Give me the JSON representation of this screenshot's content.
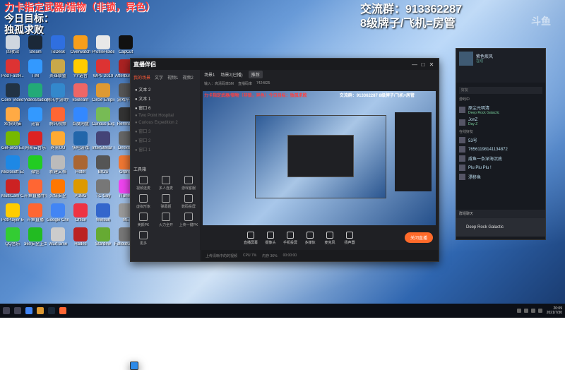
{
  "overlay": {
    "line1": "力卡指定武器/猎物（非锁，异色）",
    "line2": "今日目标：",
    "line3": "独孤求败",
    "group_label": "交流群：913362287",
    "tier_label": "8级牌子/飞机=房管",
    "watermark": "斗鱼"
  },
  "desktop_icons": [
    {
      "label": "回收站",
      "color": "#cfd6df"
    },
    {
      "label": "Steam",
      "color": "#1b2838"
    },
    {
      "label": "ToDesk",
      "color": "#2f6fe0"
    },
    {
      "label": "Overwatch",
      "color": "#f79e1b"
    },
    {
      "label": "ProfileHolder",
      "color": "#e8e8e8"
    },
    {
      "label": "CapCut",
      "color": "#111"
    },
    {
      "label": "Pod FastR...",
      "color": "#d33"
    },
    {
      "label": "TIM",
      "color": "#39f"
    },
    {
      "label": "英雄联盟",
      "color": "#c9a84a"
    },
    {
      "label": "YY语音",
      "color": "#ffcc00"
    },
    {
      "label": "WPS 2019",
      "color": "#d33"
    },
    {
      "label": "Afterburner",
      "color": "#a22"
    },
    {
      "label": "Corel VideoStudio",
      "color": "#234"
    },
    {
      "label": "VideoStudio",
      "color": "#2a7"
    },
    {
      "label": "腾讯手游助手",
      "color": "#38c"
    },
    {
      "label": "koolearn",
      "color": "#e66"
    },
    {
      "label": "Circle Empires",
      "color": "#d93"
    },
    {
      "label": "游戏平台",
      "color": "#555"
    },
    {
      "label": "欢快的猫",
      "color": "#fa4"
    },
    {
      "label": "迅雷",
      "color": "#39f"
    },
    {
      "label": "腾讯视频",
      "color": "#f63"
    },
    {
      "label": "百度网盘",
      "color": "#38f"
    },
    {
      "label": "Curious Expedition",
      "color": "#7b5"
    },
    {
      "label": "Remnant",
      "color": "#333"
    },
    {
      "label": "GeForce Experience",
      "color": "#76b900"
    },
    {
      "label": "网易云音乐",
      "color": "#d22"
    },
    {
      "label": "网易UU",
      "color": "#fa3"
    },
    {
      "label": "快吧游戏",
      "color": "#26a"
    },
    {
      "label": "InterStellar Kingdom",
      "color": "#447"
    },
    {
      "label": "Desktop",
      "color": "#666"
    },
    {
      "label": "Microsoft Edge",
      "color": "#1e88e5"
    },
    {
      "label": "微信",
      "color": "#2c2"
    },
    {
      "label": "新建文档",
      "color": "#bbb"
    },
    {
      "label": "Hotel",
      "color": "#a63"
    },
    {
      "label": "BIOS",
      "color": "#555"
    },
    {
      "label": "Orangi",
      "color": "#e73"
    },
    {
      "label": "MultiCam Capture Lite",
      "color": "#c22"
    },
    {
      "label": "斗鱼直播伴侣",
      "color": "#f63"
    },
    {
      "label": "火绒安全",
      "color": "#f70"
    },
    {
      "label": "PUBG",
      "color": "#d90"
    },
    {
      "label": "TC Guy",
      "color": "#777"
    },
    {
      "label": "iTunes",
      "color": "#e4e"
    },
    {
      "label": "PotPlayer 64 bit",
      "color": "#fc0"
    },
    {
      "label": "斗鱼直播",
      "color": "#f63"
    },
    {
      "label": "Google Chrome",
      "color": "#4285f4"
    },
    {
      "label": "Office",
      "color": "#e34"
    },
    {
      "label": "Winsun",
      "color": "#36c"
    },
    {
      "label": "ME",
      "color": "#999"
    },
    {
      "label": "QQ音乐",
      "color": "#3c3"
    },
    {
      "label": "360安全卫士",
      "color": "#2b2"
    },
    {
      "label": "Warframe",
      "color": "#ccc"
    },
    {
      "label": "Hades",
      "color": "#b22"
    },
    {
      "label": "Stardew",
      "color": "#6a3"
    },
    {
      "label": "FalloutGame",
      "color": "#777"
    }
  ],
  "broadcaster": {
    "app_title": "直播伴侣",
    "left_tabs": [
      "我的场景",
      "文字",
      "视频1",
      "视频2"
    ],
    "sources": [
      {
        "label": "文本 2",
        "dim": false
      },
      {
        "label": "文本 1",
        "dim": false
      },
      {
        "label": "窗口 6",
        "dim": false
      },
      {
        "label": "Two Point Hospital",
        "dim": true
      },
      {
        "label": "Curious Expedition 2",
        "dim": true
      },
      {
        "label": "窗口 3",
        "dim": true
      },
      {
        "label": "窗口 2",
        "dim": true
      },
      {
        "label": "窗口 1",
        "dim": true
      }
    ],
    "tools_header": "工具箱",
    "tools": [
      "视频连麦",
      "多人连麦",
      "游戏客服",
      "虚拟形象",
      "弹幕姬",
      "数码投屏",
      "美颜PK",
      "火力全开",
      "上传一键PK",
      "更多"
    ],
    "scene_tabs": [
      "场景1",
      "场景2(已播)",
      "推荐"
    ],
    "stats": [
      "输入：高清码率5M",
      "直播码率",
      "7424825"
    ],
    "preview_text_left": "力卡指定武器/猎物（非锁，异色）今日目标：独孤求败",
    "preview_text_right": "交流群：913362287 8级牌子/飞机=房管",
    "bottom_buttons": [
      "直播屏幕",
      "摄像头",
      "手机投屏",
      "多媒体",
      "麦克风",
      "扬声器"
    ],
    "live_button": "关闭直播",
    "status_items": [
      "上传清晰中的的视频",
      "CPU 7%",
      "内存 36%",
      "00:00:00"
    ]
  },
  "chat": {
    "username": "紫色疾风",
    "user_status": "在线",
    "search_placeholder": "好友",
    "playing_header": "游戏中",
    "friends_playing": [
      {
        "name": "原尘元明清",
        "sub": "Deep Rock Galactic"
      },
      {
        "name": "JonZ",
        "sub": "Day Z"
      }
    ],
    "online_header": "在线好友",
    "friends_online": [
      {
        "name": "53号",
        "sub": ""
      },
      {
        "name": "76561198141134872",
        "sub": ""
      },
      {
        "name": "咸鱼一条深海沉底",
        "sub": ""
      },
      {
        "name": "Plu Plu Plu !",
        "sub": ""
      },
      {
        "name": "漂移鱼",
        "sub": ""
      }
    ],
    "group_header": "群组聊天",
    "game_entry": "Deep Rock Galactic"
  },
  "taskbar": {
    "time": "20:09",
    "date": "2021/7/30"
  }
}
